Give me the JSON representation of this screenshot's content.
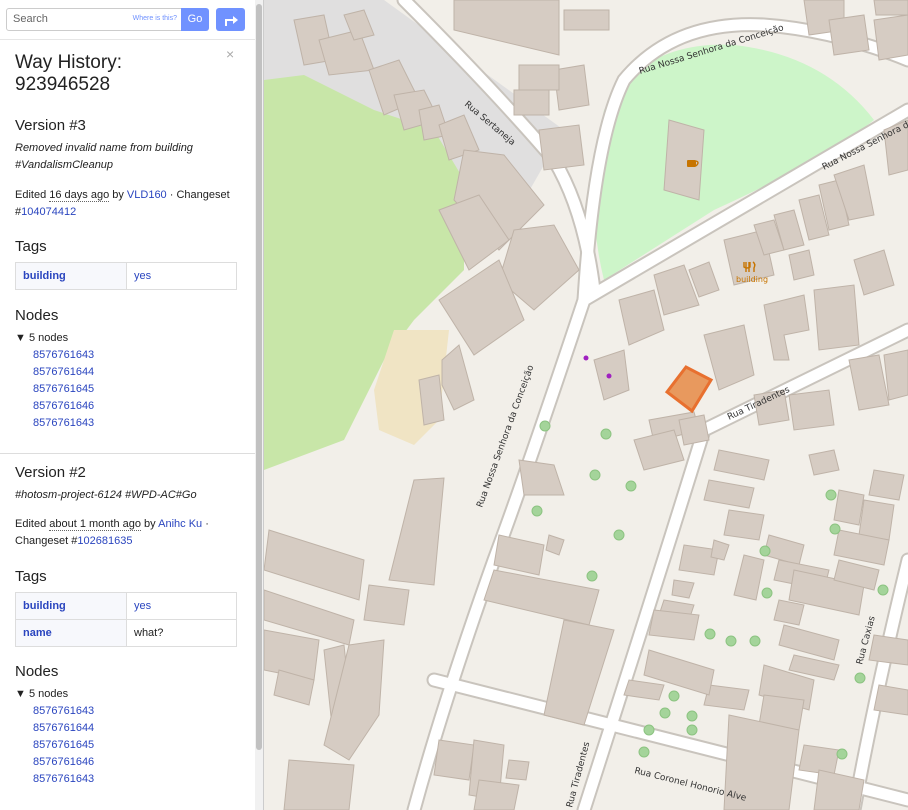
{
  "search": {
    "placeholder": "Search",
    "where_link": "Where is this?",
    "go_label": "Go"
  },
  "close_glyph": "×",
  "title_line1": "Way History:",
  "title_line2": "923946528",
  "versions": [
    {
      "heading": "Version #3",
      "comment_line1": "Removed invalid name from building",
      "comment_line2": "#VandalismCleanup",
      "edited_prefix": "Edited ",
      "edited_time": "16 days ago",
      "by": " by ",
      "user": "VLD160",
      "changeset_prefix": " · Changeset",
      "changeset_hash": "#",
      "changeset_id": "104074412",
      "tags_heading": "Tags",
      "tags": [
        {
          "key": "building",
          "value": "yes"
        }
      ],
      "nodes_heading": "Nodes",
      "nodes_summary": "▼ 5 nodes",
      "nodes": [
        "8576761643",
        "8576761644",
        "8576761645",
        "8576761646",
        "8576761643"
      ]
    },
    {
      "heading": "Version #2",
      "comment_line1": "#hotosm-project-6124 #WPD-AC#Go",
      "edited_prefix": "Edited ",
      "edited_time": "about 1 month ago",
      "by": " by ",
      "user": "Anihc Ku",
      "changeset_prefix": " ·",
      "changeset_line2": "Changeset #",
      "changeset_id": "102681635",
      "tags_heading": "Tags",
      "tags": [
        {
          "key": "building",
          "value": "yes"
        },
        {
          "key": "name",
          "value": "what?"
        }
      ],
      "nodes_heading": "Nodes",
      "nodes_summary": "▼ 5 nodes",
      "nodes": [
        "8576761643",
        "8576761644",
        "8576761645",
        "8576761646",
        "8576761643"
      ]
    }
  ],
  "map": {
    "streets": {
      "conceicao_top": "Rua Nossa Senhora da Conceição",
      "sertaneja": "Rua Sertaneja",
      "conceicao_right": "Rua Nossa Senhora da",
      "conceicao_vertical": "Rua Nossa Senhora da Conceição",
      "tiradentes": "Rua Tiradentes",
      "tiradentes_bottom": "Rua Tiradentes",
      "coronel": "Rua Coronel Honorio Alve",
      "caxias": "Rua Caxias"
    },
    "poi_label": "building",
    "colors": {
      "park": "#cdf5c9",
      "wood": "#c8e6a8",
      "sand": "#f0e4c4",
      "building": "#d6ccc3",
      "highlight": "#e87b2f"
    }
  }
}
